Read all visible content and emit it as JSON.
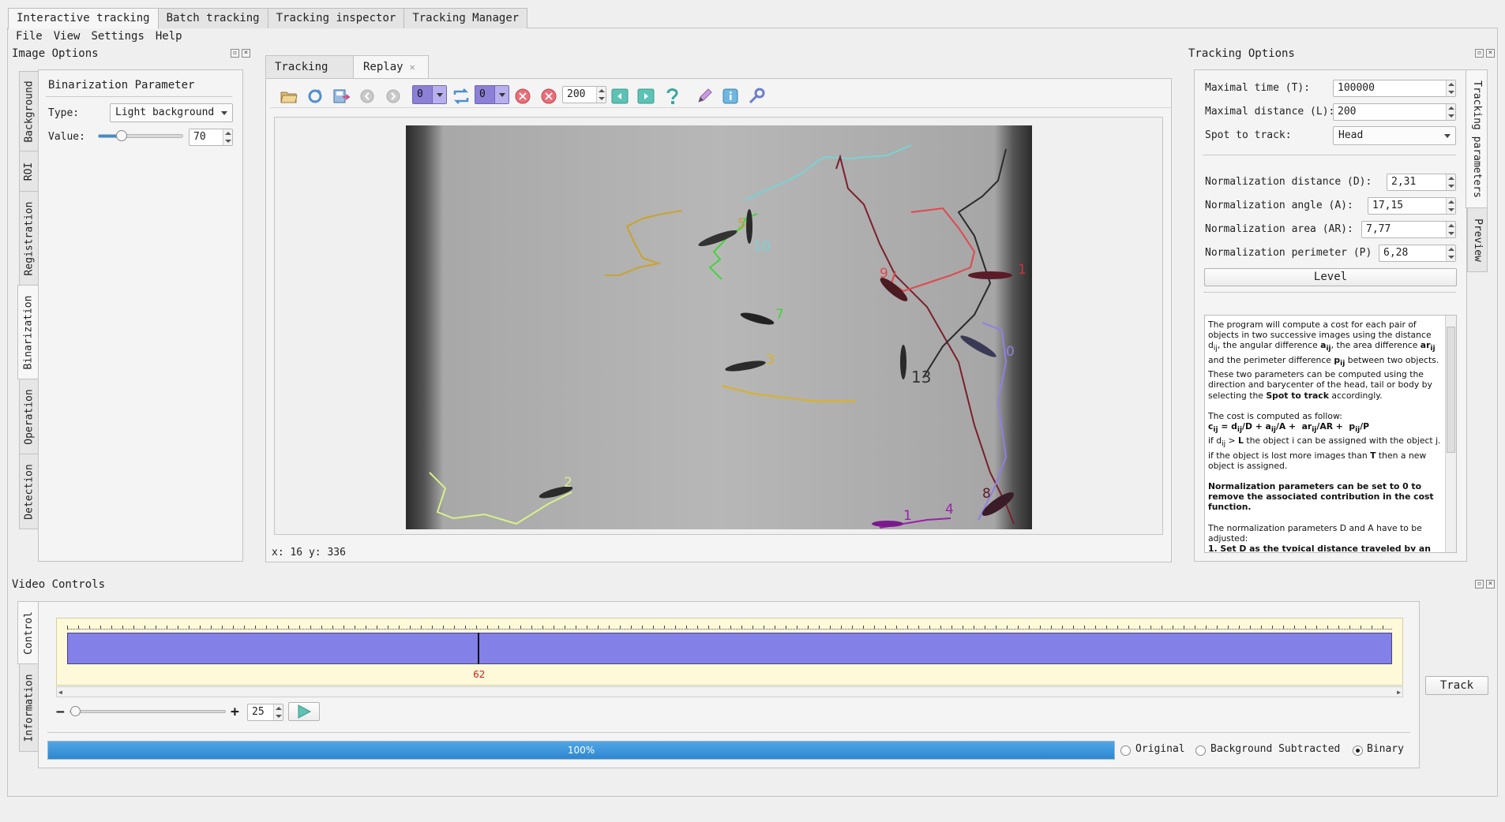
{
  "top_tabs": [
    "Interactive tracking",
    "Batch tracking",
    "Tracking inspector",
    "Tracking Manager"
  ],
  "menu": [
    "File",
    "View",
    "Settings",
    "Help"
  ],
  "image_options": {
    "title": "Image Options",
    "vtabs": [
      "Background",
      "ROI",
      "Registration",
      "Binarization",
      "Operation",
      "Detection"
    ],
    "section_title": "Binarization Parameter",
    "type_label": "Type:",
    "type_value": "Light background",
    "value_label": "Value:",
    "value": "70",
    "slider_fraction": 0.27
  },
  "center": {
    "tabs": [
      "Tracking",
      "Replay"
    ],
    "frame_a": "0",
    "frame_b": "0",
    "interval": "200",
    "coords": "x: 16 y: 336",
    "track_labels": [
      "5",
      "10",
      "7",
      "3",
      "9",
      "13",
      "1",
      "0",
      "2",
      "1",
      "4",
      "8"
    ]
  },
  "tracking_options": {
    "title": "Tracking Options",
    "vtabs": [
      "Tracking parameters",
      "Preview"
    ],
    "max_time_label": "Maximal time (T):",
    "max_time": "100000",
    "max_dist_label": "Maximal distance (L):",
    "max_dist": "200",
    "spot_label": "Spot to track:",
    "spot_value": "Head",
    "norm_dist_label": "Normalization distance (D):",
    "norm_dist": "2,31",
    "norm_angle_label": "Normalization angle (A):",
    "norm_angle": "17,15",
    "norm_area_label": "Normalization area (AR):",
    "norm_area": "7,77",
    "norm_perim_label": "Normalization perimeter (P)",
    "norm_perim": "6,28",
    "level_button": "Level",
    "help_p1": "The program will compute a cost for each pair of objects in two successive images using the distance d",
    "help_cost_title": "The cost is computed as follow:",
    "help_bold": "Normalization parameters can be set to 0 to remove the associated contribution in the cost function.",
    "help_last": "The normalization parameters D and A have to be adjusted:",
    "help_step1": "1. Set D as the typical distance traveled by an"
  },
  "video_controls": {
    "title": "Video Controls",
    "vtabs": [
      "Control",
      "Information"
    ],
    "current_frame": "62",
    "current_fraction": 0.31,
    "speed": "25",
    "progress_label": "100%",
    "progress_fraction": 1.0,
    "radios": [
      "Original",
      "Background Subtracted",
      "Binary"
    ],
    "selected_radio": "Binary",
    "track_button": "Track"
  }
}
